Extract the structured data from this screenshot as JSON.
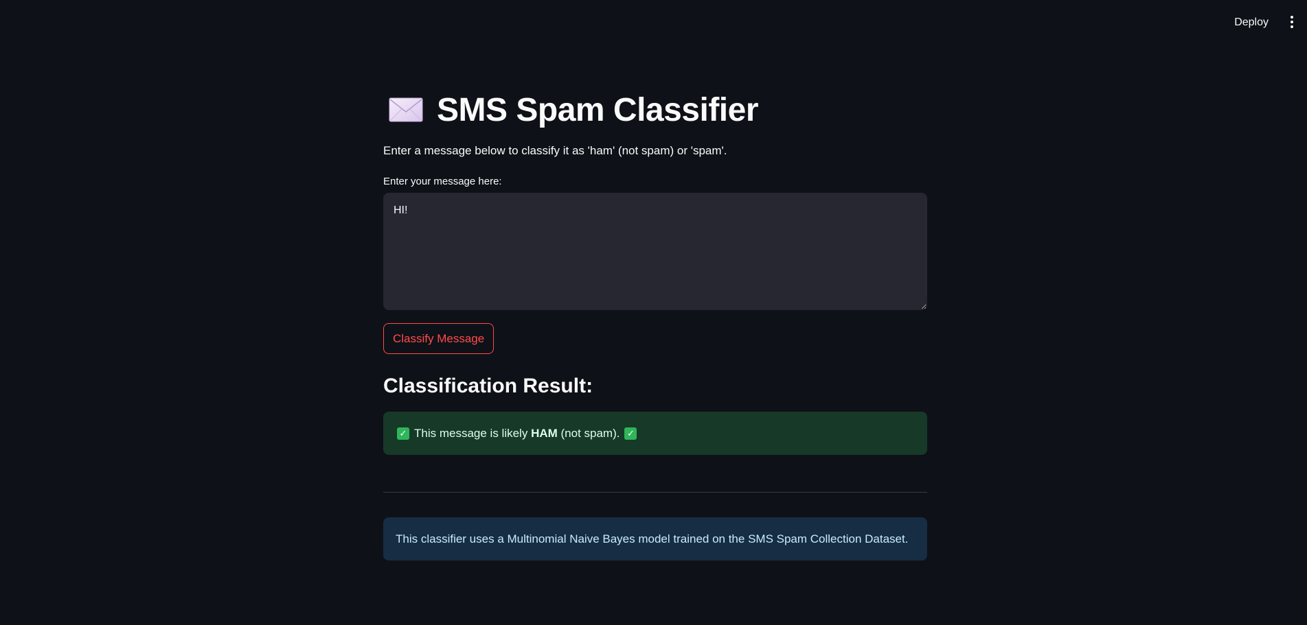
{
  "header": {
    "deploy_label": "Deploy",
    "menu_icon": "vertical-ellipsis-icon"
  },
  "page": {
    "title_icon": "envelope-icon",
    "title": "SMS Spam Classifier",
    "description": "Enter a message below to classify it as 'ham' (not spam) or 'spam'."
  },
  "form": {
    "label": "Enter your message here:",
    "value": "HI!",
    "button_label": "Classify Message"
  },
  "result": {
    "heading": "Classification Result:",
    "icon": "check-mark-icon",
    "prefix": "This message is likely ",
    "label": "HAM",
    "suffix": " (not spam)."
  },
  "info": {
    "text": "This classifier uses a Multinomial Naive Bayes model trained on the SMS Spam Collection Dataset."
  },
  "colors": {
    "background": "#0e1117",
    "primary": "#ff4b4b",
    "success_bg": "#173928",
    "info_bg": "#172d43",
    "input_bg": "#262730"
  }
}
